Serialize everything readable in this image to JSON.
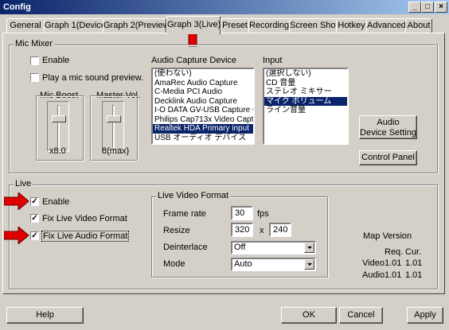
{
  "window": {
    "title": "Config",
    "controls": {
      "minimize": "_",
      "maximize": "□",
      "close": "×"
    }
  },
  "tabs": [
    {
      "label": "General"
    },
    {
      "label": "Graph 1(Device)"
    },
    {
      "label": "Graph 2(Preview)"
    },
    {
      "label": "Graph 3(Live)",
      "active": true
    },
    {
      "label": "Preset"
    },
    {
      "label": "Recording"
    },
    {
      "label": "Screen Shot"
    },
    {
      "label": "Hotkey"
    },
    {
      "label": "Advanced"
    },
    {
      "label": "About"
    }
  ],
  "mic_mixer": {
    "group_label": "Mic Mixer",
    "enable_label": "Enable",
    "enable_checked": false,
    "play_label": "Play a mic sound preview.",
    "play_checked": false,
    "mic_boost": {
      "label": "Mic Boost",
      "value": "x8.0",
      "level": 0.72
    },
    "master_vol": {
      "label": "Master Vol.",
      "value": "8(max)",
      "level": 0.72
    },
    "audio_device_label": "Audio Capture Device",
    "audio_devices": [
      {
        "label": "(使わない)",
        "selected": false
      },
      {
        "label": "AmaRec Audio Capture",
        "selected": false
      },
      {
        "label": "C-Media PCI Audio",
        "selected": false
      },
      {
        "label": "Decklink Audio Capture",
        "selected": false
      },
      {
        "label": "I-O DATA GV-USB Capture Ca",
        "selected": false
      },
      {
        "label": "Philips Cap713x Video Captu",
        "selected": false
      },
      {
        "label": "Realtek HDA Primary input",
        "selected": true
      },
      {
        "label": "USB オーディオ デバイス",
        "selected": false
      }
    ],
    "input_label": "Input",
    "inputs": [
      {
        "label": "(選択しない)",
        "selected": false
      },
      {
        "label": "CD 音量",
        "selected": false
      },
      {
        "label": "ステレオ ミキサー",
        "selected": false
      },
      {
        "label": "マイク ボリューム",
        "selected": true
      },
      {
        "label": "ライン音量",
        "selected": false
      }
    ],
    "audio_device_setting_line1": "Audio",
    "audio_device_setting_line2": "Device Setting",
    "control_panel": "Control Panel"
  },
  "live": {
    "group_label": "Live",
    "enable_label": "Enable",
    "enable_checked": true,
    "fix_video_label": "Fix Live Video Format",
    "fix_video_checked": true,
    "fix_audio_label": "Fix Live Audio Format",
    "fix_audio_checked": true,
    "video_format": {
      "group_label": "Live Video Format",
      "frame_rate_label": "Frame rate",
      "frame_rate_value": "30",
      "fps_unit": "fps",
      "resize_label": "Resize",
      "resize_w": "320",
      "resize_x": "x",
      "resize_h": "240",
      "deinterlace_label": "Deinterlace",
      "deinterlace_value": "Off",
      "mode_label": "Mode",
      "mode_value": "Auto"
    },
    "map_version": {
      "title": "Map Version",
      "req_header": "Req.",
      "cur_header": "Cur.",
      "rows": [
        {
          "name": "Video",
          "req": "1.01",
          "cur": "1.01"
        },
        {
          "name": "Audio",
          "req": "1.01",
          "cur": "1.01"
        }
      ]
    }
  },
  "footer": {
    "help": "Help",
    "ok": "OK",
    "cancel": "Cancel",
    "apply": "Apply"
  },
  "colors": {
    "face": "#d4d0c8",
    "selection": "#0a246a",
    "title_start": "#0a246a",
    "title_end": "#a6caf0",
    "annotation_arrow": "#e00000"
  }
}
